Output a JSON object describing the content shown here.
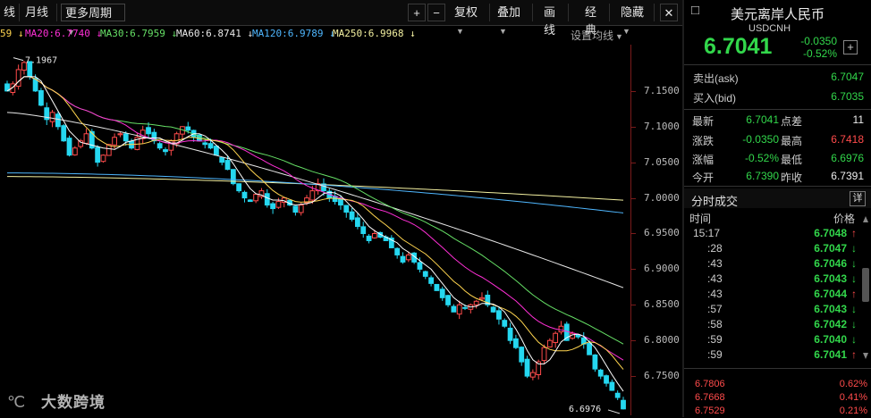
{
  "toolbar": {
    "left_items": [
      "线",
      "月线",
      "更多周期"
    ],
    "right_items": [
      "复权",
      "叠加",
      "画线",
      "经典",
      "隐藏"
    ],
    "plus": "+",
    "minus": "−",
    "close": "✕"
  },
  "ma_legend": [
    {
      "label": "59",
      "color": "#ffd54f"
    },
    {
      "label": "MA20:6.7740",
      "color": "#ff2fd6"
    },
    {
      "label": "MA30:6.7959",
      "color": "#66e066"
    },
    {
      "label": "MA60:6.8741",
      "color": "#e8e8e8"
    },
    {
      "label": "MA120:6.9789",
      "color": "#4fb7ff"
    },
    {
      "label": "MA250:6.9968",
      "color": "#f3f0a0"
    }
  ],
  "ma_setting": "设置均线",
  "chart_data": {
    "type": "candlestick",
    "title": "",
    "ylim": [
      6.695,
      7.215
    ],
    "y_ticks": [
      7.15,
      7.1,
      7.05,
      7.0,
      6.95,
      6.9,
      6.85,
      6.8,
      6.75
    ],
    "y_tick_labels": [
      "7.1500",
      "7.1000",
      "7.0500",
      "7.0000",
      "6.9500",
      "6.9000",
      "6.8500",
      "6.8000",
      "6.7500"
    ],
    "annotations": [
      {
        "text": "7.1967",
        "value": 7.1967
      },
      {
        "text": "6.6976",
        "value": 6.6976
      }
    ],
    "colors": {
      "up": "#ff4b4b",
      "down": "#25d7f0",
      "ma5": "#ffffff",
      "ma10": "#ffd54f",
      "ma20": "#ff2fd6",
      "ma30": "#66e066",
      "ma60": "#e8e8e8",
      "ma120": "#4fb7ff",
      "ma250": "#f3f0a0"
    },
    "closes": [
      7.15,
      7.16,
      7.18,
      7.19,
      7.17,
      7.15,
      7.13,
      7.11,
      7.12,
      7.1,
      7.08,
      7.06,
      7.07,
      7.08,
      7.09,
      7.07,
      7.05,
      7.06,
      7.075,
      7.085,
      7.09,
      7.08,
      7.07,
      7.085,
      7.095,
      7.09,
      7.08,
      7.07,
      7.065,
      7.08,
      7.09,
      7.1,
      7.095,
      7.085,
      7.08,
      7.075,
      7.07,
      7.06,
      7.05,
      7.04,
      7.02,
      7.01,
      7.0,
      6.995,
      7.005,
      7.01,
      6.99,
      6.985,
      6.995,
      7.0,
      6.99,
      6.98,
      6.99,
      7.0,
      7.01,
      7.02,
      7.01,
      7.0,
      6.995,
      6.99,
      6.98,
      6.97,
      6.96,
      6.95,
      6.94,
      6.95,
      6.945,
      6.94,
      6.93,
      6.92,
      6.91,
      6.92,
      6.91,
      6.9,
      6.89,
      6.88,
      6.87,
      6.86,
      6.85,
      6.84,
      6.85,
      6.845,
      6.85,
      6.855,
      6.86,
      6.85,
      6.84,
      6.83,
      6.82,
      6.8,
      6.79,
      6.77,
      6.75,
      6.755,
      6.77,
      6.79,
      6.8,
      6.81,
      6.82,
      6.8,
      6.81,
      6.805,
      6.795,
      6.78,
      6.76,
      6.75,
      6.74,
      6.73,
      6.72,
      6.704
    ]
  },
  "panel": {
    "title": "美元离岸人民币",
    "code": "USDCNH",
    "last": "6.7041",
    "change": "-0.0350",
    "change_pct": "-0.52%",
    "add": "+",
    "close": "□",
    "ask_label": "卖出(ask)",
    "ask": "6.7047",
    "bid_label": "买入(bid)",
    "bid": "6.7035",
    "stats": [
      {
        "l1": "最新",
        "v1": "6.7041",
        "c1": "green",
        "l2": "点差",
        "v2": "11",
        "c2": "white"
      },
      {
        "l1": "涨跌",
        "v1": "-0.0350",
        "c1": "green",
        "l2": "最高",
        "v2": "6.7418",
        "c2": "red"
      },
      {
        "l1": "涨幅",
        "v1": "-0.52%",
        "c1": "green",
        "l2": "最低",
        "v2": "6.6976",
        "c2": "green"
      },
      {
        "l1": "今开",
        "v1": "6.7390",
        "c1": "green",
        "l2": "昨收",
        "v2": "6.7391",
        "c2": "white"
      }
    ],
    "ticks_title": "分时成交",
    "ticks_detail": "详",
    "col_time": "时间",
    "col_price": "价格",
    "ticks": [
      {
        "time": "15:17",
        "price": "6.7048",
        "dir": "up"
      },
      {
        "time": ":28",
        "price": "6.7047",
        "dir": "down"
      },
      {
        "time": ":43",
        "price": "6.7046",
        "dir": "down"
      },
      {
        "time": ":43",
        "price": "6.7043",
        "dir": "down"
      },
      {
        "time": ":43",
        "price": "6.7044",
        "dir": "up"
      },
      {
        "time": ":57",
        "price": "6.7043",
        "dir": "down"
      },
      {
        "time": ":58",
        "price": "6.7042",
        "dir": "down"
      },
      {
        "time": ":59",
        "price": "6.7040",
        "dir": "down"
      },
      {
        "time": ":59",
        "price": "6.7041",
        "dir": "up"
      }
    ],
    "depth": [
      {
        "price": "6.7806",
        "pct": "0.62%"
      },
      {
        "price": "6.7668",
        "pct": "0.41%"
      },
      {
        "price": "6.7529",
        "pct": "0.21%"
      }
    ]
  },
  "watermark": "大数跨境"
}
